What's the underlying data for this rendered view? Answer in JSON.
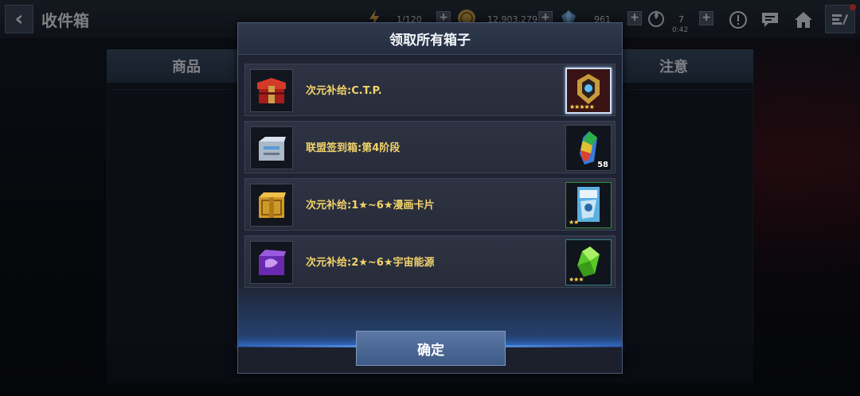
{
  "topbar": {
    "title": "收件箱",
    "energy": "1/120",
    "gold": "12,903,279",
    "crystals": "961",
    "battle_count": "7",
    "timer": "0:42"
  },
  "background": {
    "tab_left": "商品",
    "tab_right": "注意"
  },
  "modal": {
    "title": "领取所有箱子",
    "confirm_label": "确定",
    "rows": [
      {
        "label": "次元补给:C.T.P.",
        "reward_stars": "★★★★★",
        "reward_qty": ""
      },
      {
        "label": "联盟签到箱:第4阶段",
        "reward_stars": "",
        "reward_qty": "58"
      },
      {
        "label": "次元补给:1★~6★漫画卡片",
        "reward_stars": "★★",
        "reward_qty": ""
      },
      {
        "label": "次元补给:2★~6★宇宙能源",
        "reward_stars": "★★★",
        "reward_qty": ""
      }
    ]
  },
  "colors": {
    "label_gold": "#f3d36a",
    "confirm_button": "#4a6794",
    "glow_blue": "#6aa8ff"
  },
  "icons": [
    "back-arrow-icon",
    "energy-icon",
    "gold-coin-icon",
    "crystal-icon",
    "battle-icon",
    "alert-icon",
    "chat-icon",
    "home-icon",
    "menu-icon"
  ]
}
